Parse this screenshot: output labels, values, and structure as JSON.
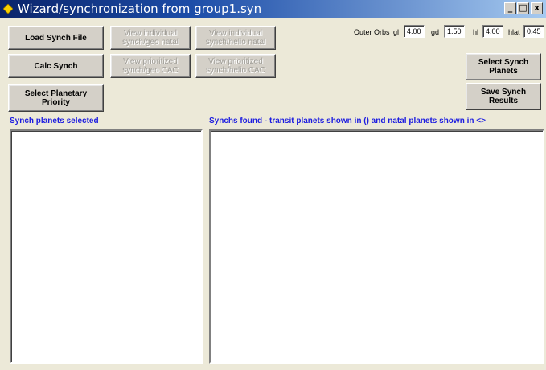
{
  "window": {
    "title": "Wizard/synchronization from group1.syn",
    "controls": {
      "minimize": "_",
      "maximize": "□",
      "close": "x"
    }
  },
  "buttons": {
    "load_synch_file": "Load Synch File",
    "calc_synch": "Calc Synch",
    "select_planetary_priority": "Select Planetary\nPriority",
    "view_individual_geo_natal": "View individual\nsynch/geo natal",
    "view_individual_helio_natal": "View individual\nsynch/helio natal",
    "view_prioritized_geo_cac": "View prioritized\nsynch/geo CAC",
    "view_prioritized_helio_cac": "View prioritized\nsynch/helio CAC",
    "select_synch_planets": "Select Synch\nPlanets",
    "save_synch_results": "Save Synch\nResults"
  },
  "outer_orbs": {
    "label": "Outer Orbs",
    "gl_label": "gl",
    "gl_value": "4.00",
    "gd_label": "gd",
    "gd_value": "1.50",
    "hl_label": "hl",
    "hl_value": "4.00",
    "hlat_label": "hlat",
    "hlat_value": "0.45"
  },
  "sections": {
    "synch_planets_selected": "Synch planets selected",
    "synchs_found": "Synchs found - transit planets shown in () and natal planets shown in <>"
  },
  "colors": {
    "titlebar_start": "#0A246A",
    "titlebar_end": "#A6CAF0",
    "section_label": "#1C1CE0",
    "window_bg": "#ECE9D8",
    "disabled_text": "#A09E98"
  },
  "icons": {
    "app": "yellow-diamond-icon"
  }
}
